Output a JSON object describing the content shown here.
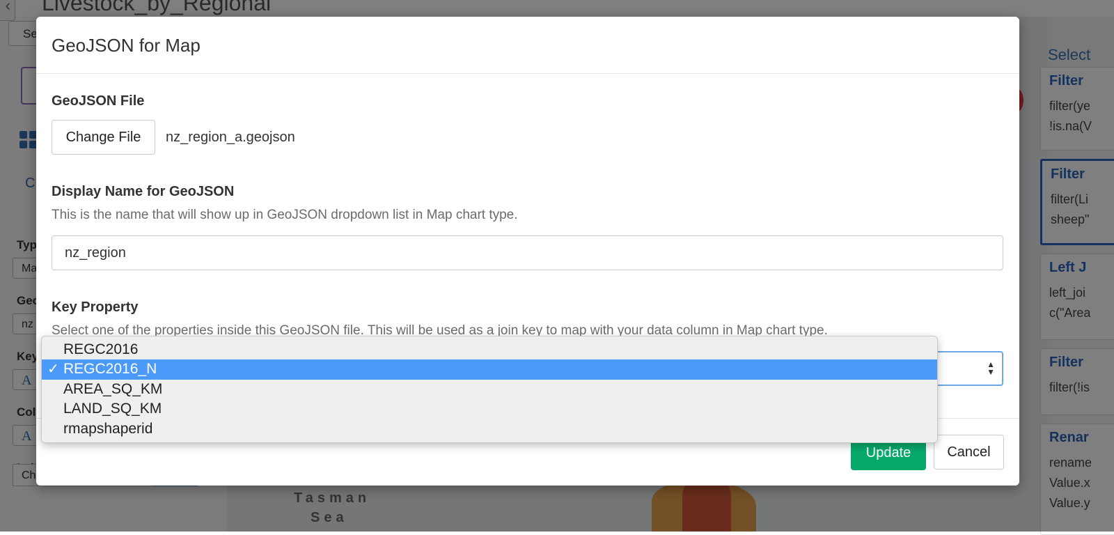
{
  "background": {
    "app_title": "Livestock_by_Regional",
    "back_icon": "chevron-left-icon",
    "select_button_label": "Se",
    "left_panel": {
      "c_label": "C",
      "type_label": "Typ",
      "type_value": "Ma",
      "geo_label": "Geo",
      "geo_value": "nz",
      "key_label": "Key",
      "key_value_icon": "A",
      "col_label": "Col",
      "col_value_icon": "A",
      "label_label": "Lab",
      "label_choose": "Choose...",
      "label_choose_btn": "-"
    },
    "map_labels": [
      "Tasman",
      "Sea"
    ],
    "right_panel": {
      "select_link": "Select",
      "steps": [
        {
          "title": "Filter",
          "lines": [
            "filter(ye",
            "!is.na(V"
          ]
        },
        {
          "title": "Filter",
          "lines": [
            "filter(Li",
            "sheep\""
          ]
        },
        {
          "title": "Left J",
          "lines": [
            "left_joi",
            "c(\"Area"
          ]
        },
        {
          "title": "Filter",
          "lines": [
            "filter(!is"
          ]
        },
        {
          "title": "Renar",
          "lines": [
            "rename",
            "Value.x",
            "Value.y"
          ]
        }
      ]
    }
  },
  "modal": {
    "title": "GeoJSON for Map",
    "geojson_file": {
      "label": "GeoJSON File",
      "change_button": "Change File",
      "file_name": "nz_region_a.geojson"
    },
    "display_name": {
      "label": "Display Name for GeoJSON",
      "help": "This is the name that will show up in GeoJSON dropdown list in Map chart type.",
      "value": "nz_region"
    },
    "key_property": {
      "label": "Key Property",
      "help": "Select one of the properties inside this GeoJSON file. This will be used as a join key to map with your data column in Map chart type.",
      "selected": "REGC2016_N",
      "options": [
        "REGC2016",
        "REGC2016_N",
        "AREA_SQ_KM",
        "LAND_SQ_KM",
        "rmapshaperid"
      ],
      "check_mark": "✓"
    },
    "footer": {
      "update_label": "Update",
      "cancel_label": "Cancel"
    }
  },
  "colors": {
    "accent_blue": "#4b9afa",
    "update_green": "#07a96b",
    "step_title_blue": "#2c62b6"
  }
}
